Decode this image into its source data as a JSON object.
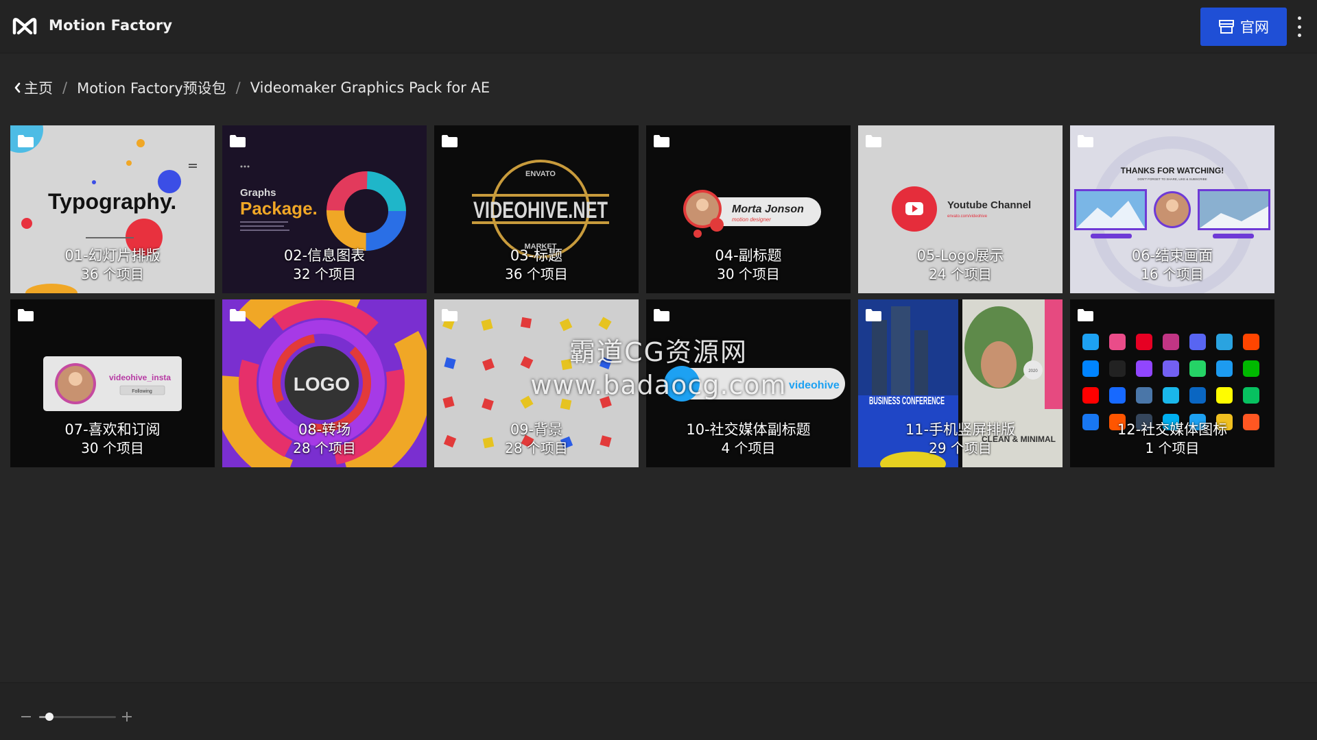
{
  "header": {
    "app_title": "Motion Factory",
    "site_button_label": "官网"
  },
  "breadcrumb": {
    "items": [
      "主页",
      "Motion Factory预设包",
      "Videomaker Graphics Pack for AE"
    ],
    "separator": "/"
  },
  "folders": [
    {
      "name": "01-幻灯片排版",
      "count": "36 个项目",
      "thumb_text": "Typography."
    },
    {
      "name": "02-信息图表",
      "count": "32 个项目",
      "thumb_text": "Package.",
      "thumb_sub": "Graphs"
    },
    {
      "name": "03-标题",
      "count": "36 个项目",
      "thumb_text": "VIDEOHIVE.NET",
      "thumb_top": "ENVATO",
      "thumb_bottom": "MARKET"
    },
    {
      "name": "04-副标题",
      "count": "30 个项目",
      "thumb_text": "Morta Jonson",
      "thumb_sub": "motion designer"
    },
    {
      "name": "05-Logo展示",
      "count": "24 个项目",
      "thumb_text": "Youtube Channel",
      "thumb_sub": "envato.com/videohive"
    },
    {
      "name": "06-结束画面",
      "count": "16 个项目",
      "thumb_text": "THANKS FOR WATCHING!",
      "thumb_sub": "DON'T FORGET TO SHARE, LIKE & SUBSCRIBE"
    },
    {
      "name": "07-喜欢和订阅",
      "count": "30 个项目",
      "thumb_text": "videohive_insta",
      "thumb_sub": "Following"
    },
    {
      "name": "08-转场",
      "count": "28 个项目",
      "thumb_text": "LOGO"
    },
    {
      "name": "09-背景",
      "count": "28 个项目"
    },
    {
      "name": "10-社交媒体副标题",
      "count": "4 个项目",
      "thumb_text": "videohive"
    },
    {
      "name": "11-手机竖屏排版",
      "count": "29 个项目",
      "thumb_text": "BUSINESS CONFERENCE",
      "thumb_sub": "CLEAN & MINIMAL",
      "thumb_badge": "2020"
    },
    {
      "name": "12-社交媒体图标",
      "count": "1 个项目"
    }
  ],
  "watermark": {
    "line1": "霸道CG资源网",
    "line2": "www.badaocg.com"
  },
  "zoom": {
    "level": 0.13
  },
  "colors": {
    "accent": "#1f4fd6",
    "background": "#262626",
    "topbar": "#232323"
  }
}
